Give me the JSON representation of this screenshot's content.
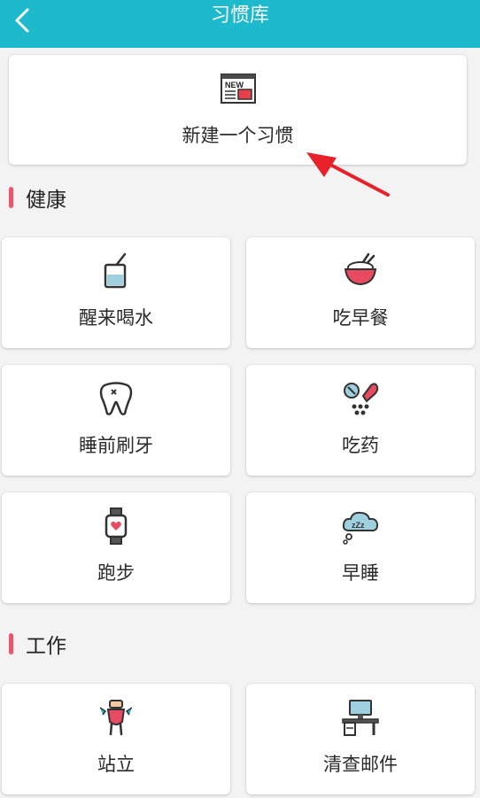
{
  "header": {
    "title": "习惯库"
  },
  "new_habit": {
    "label": "新建一个习惯",
    "icon": "new-newspaper-icon"
  },
  "sections": [
    {
      "title": "健康",
      "items": [
        {
          "label": "醒来喝水",
          "icon": "water-glass-icon"
        },
        {
          "label": "吃早餐",
          "icon": "rice-bowl-icon"
        },
        {
          "label": "睡前刷牙",
          "icon": "tooth-icon"
        },
        {
          "label": "吃药",
          "icon": "pills-icon"
        },
        {
          "label": "跑步",
          "icon": "smartwatch-icon"
        },
        {
          "label": "早睡",
          "icon": "sleep-cloud-icon"
        }
      ]
    },
    {
      "title": "工作",
      "items": [
        {
          "label": "站立",
          "icon": "standing-figure-icon"
        },
        {
          "label": "清查邮件",
          "icon": "computer-desk-icon"
        }
      ]
    }
  ],
  "colors": {
    "header": "#1db9cc",
    "accent_bar": "#f0546a",
    "annotation_arrow": "#e8202a"
  }
}
